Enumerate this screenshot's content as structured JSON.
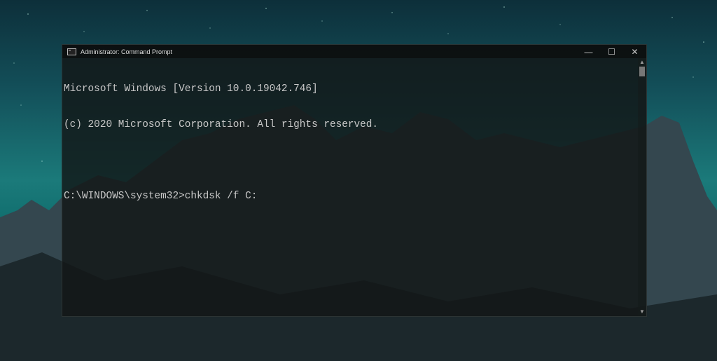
{
  "window": {
    "title": "Administrator: Command Prompt",
    "controls": {
      "minimize": "—",
      "maximize": "☐",
      "close": "✕"
    }
  },
  "console": {
    "lines": [
      "Microsoft Windows [Version 10.0.19042.746]",
      "(c) 2020 Microsoft Corporation. All rights reserved.",
      "",
      "C:\\WINDOWS\\system32>chkdsk /f C:"
    ]
  },
  "scrollbar": {
    "up": "▲",
    "down": "▼"
  }
}
